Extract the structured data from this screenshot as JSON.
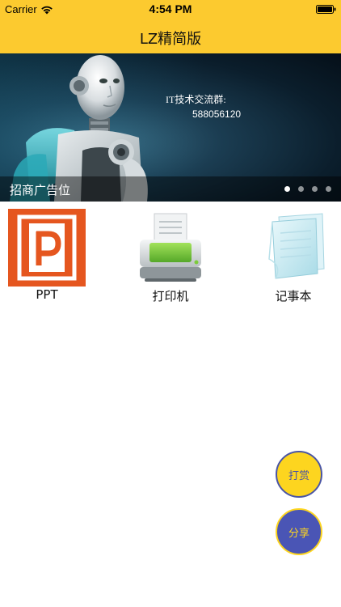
{
  "status_bar": {
    "carrier": "Carrier",
    "time": "4:54 PM",
    "wifi_icon": "wifi-icon",
    "battery_icon": "battery-icon"
  },
  "nav": {
    "title": "LZ精简版"
  },
  "banner": {
    "title_line": "IT技术交流群:",
    "group_number": "588056120",
    "caption": "招商广告位",
    "page_count": 4,
    "active_page": 1
  },
  "apps": [
    {
      "label": "PPT",
      "icon": "ppt-icon"
    },
    {
      "label": "打印机",
      "icon": "printer-icon"
    },
    {
      "label": "记事本",
      "icon": "notepad-icon"
    }
  ],
  "fabs": {
    "reward_label": "打赏",
    "share_label": "分享"
  },
  "colors": {
    "nav_bar": "#fcca2f",
    "fab_yellow": "#fdd51f",
    "fab_blue": "#4a55b5",
    "ppt_orange": "#e5561f",
    "printer_green": "#7ccb3b"
  }
}
